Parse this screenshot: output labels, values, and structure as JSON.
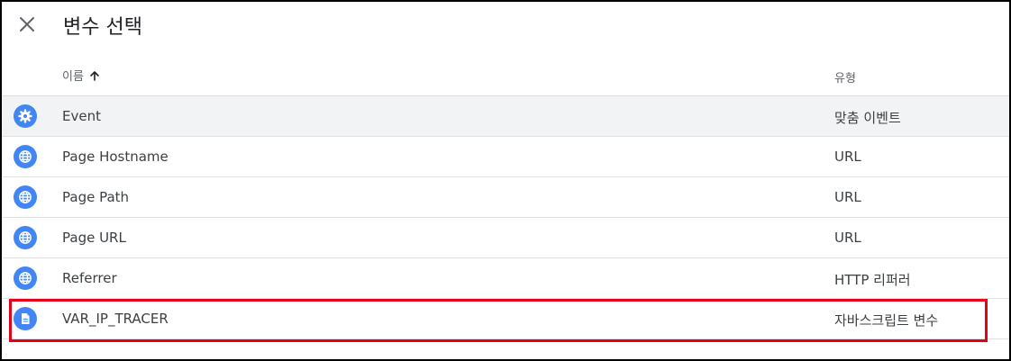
{
  "dialog": {
    "title": "변수 선택"
  },
  "header": {
    "name_label": "이름",
    "type_label": "유형"
  },
  "rows": [
    {
      "name": "Event",
      "type": "맞춤 이벤트",
      "icon": "gear-icon"
    },
    {
      "name": "Page Hostname",
      "type": "URL",
      "icon": "globe-icon"
    },
    {
      "name": "Page Path",
      "type": "URL",
      "icon": "globe-icon"
    },
    {
      "name": "Page URL",
      "type": "URL",
      "icon": "globe-icon"
    },
    {
      "name": "Referrer",
      "type": "HTTP 리퍼러",
      "icon": "globe-icon"
    },
    {
      "name": "VAR_IP_TRACER",
      "type": "자바스크립트 변수",
      "icon": "document-icon"
    }
  ],
  "colors": {
    "accent": "#4285f4",
    "highlight": "#e3001b"
  }
}
